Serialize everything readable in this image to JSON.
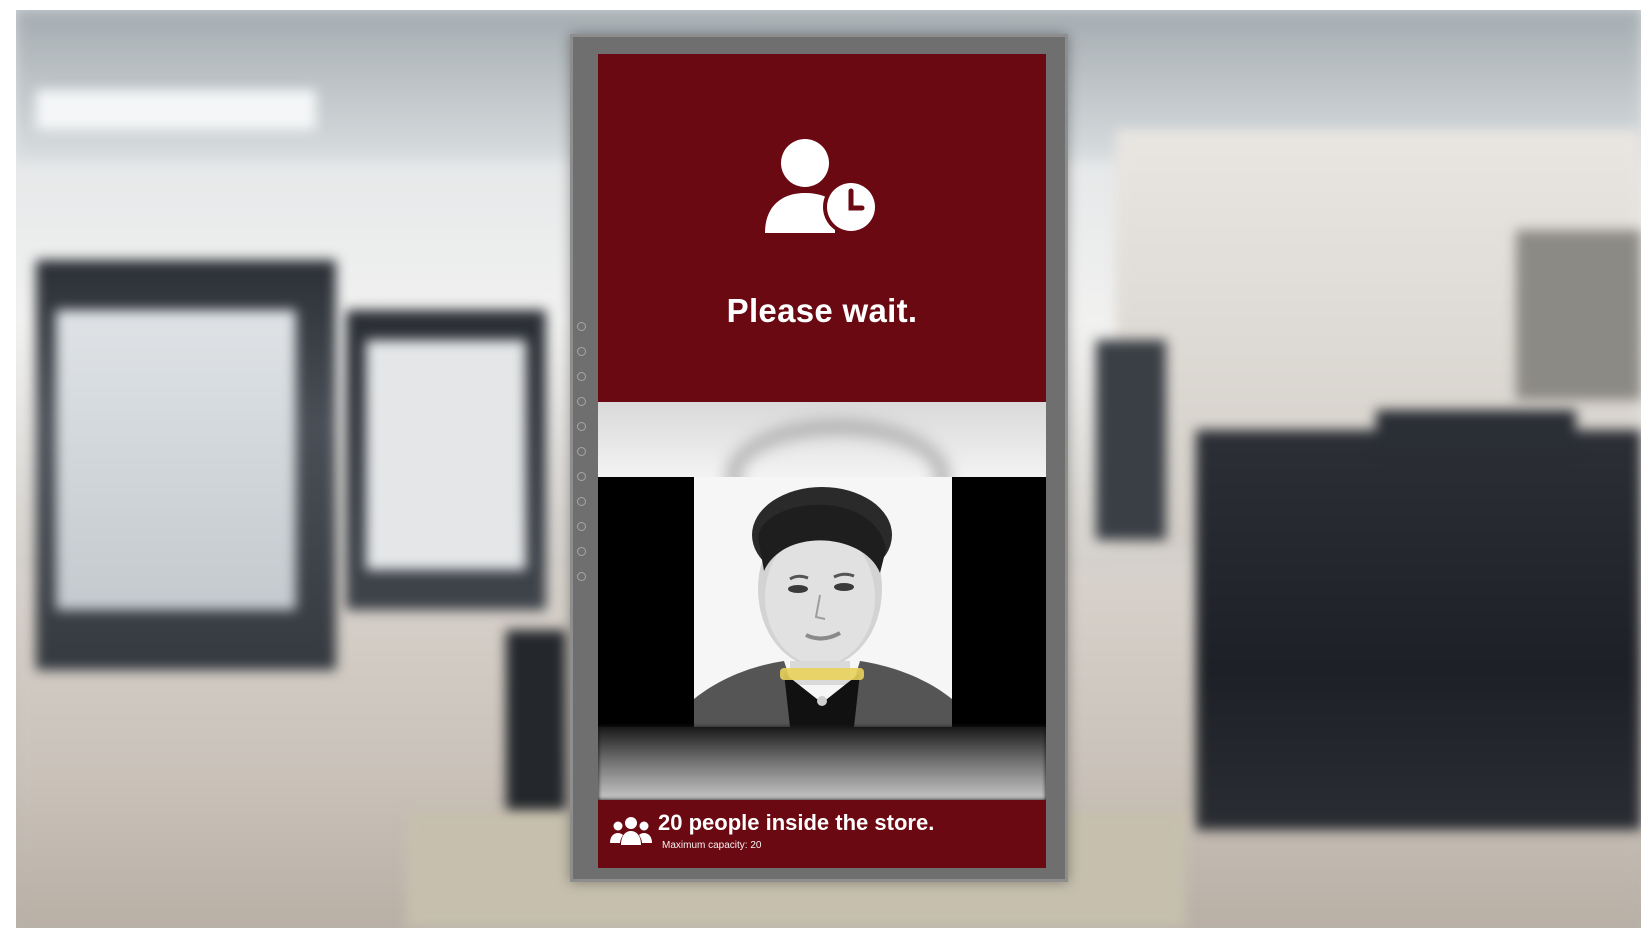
{
  "screen": {
    "status_icon": "person-clock-icon",
    "status_title": "Please wait.",
    "camera_feed": "face-camera-preview",
    "occupancy": {
      "icon": "people-group-icon",
      "count_text": "20 people inside the store.",
      "capacity_text": "Maximum capacity: 20"
    }
  },
  "colors": {
    "panel": "#6a0911",
    "text": "#ffffff"
  }
}
